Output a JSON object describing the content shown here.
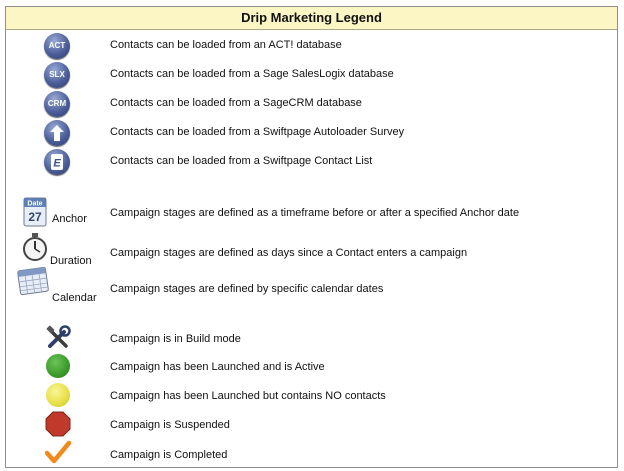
{
  "legend": {
    "title": "Drip Marketing Legend",
    "data_sources": [
      {
        "icon": "act-database-icon",
        "badge": "ACT",
        "text": "Contacts can be loaded from an ACT! database"
      },
      {
        "icon": "sage-saleslogix-icon",
        "badge": "SLX",
        "text": "Contacts can be loaded from a Sage SalesLogix database"
      },
      {
        "icon": "sagecrm-icon",
        "badge": "CRM",
        "text": "Contacts can be loaded from a SageCRM database"
      },
      {
        "icon": "autoloader-survey-icon",
        "badge": "",
        "text": "Contacts can be loaded from a Swiftpage Autoloader Survey"
      },
      {
        "icon": "contact-list-icon",
        "badge": "E",
        "text": "Contacts can be loaded from a Swiftpage Contact List"
      }
    ],
    "timeline_types": [
      {
        "icon": "anchor-date-icon",
        "label": "Anchor",
        "calendar_top": "Date",
        "calendar_day": "27",
        "text": "Campaign stages are defined as a timeframe before or after a specified Anchor date"
      },
      {
        "icon": "stopwatch-icon",
        "label": "Duration",
        "text": "Campaign stages are defined as days since a Contact enters a campaign"
      },
      {
        "icon": "calendar-icon",
        "label": "Calendar",
        "text": "Campaign stages are defined by specific calendar dates"
      }
    ],
    "statuses": [
      {
        "icon": "build-tools-icon",
        "text": "Campaign is in Build mode"
      },
      {
        "icon": "green-dot-icon",
        "color": "#3b9a2a",
        "text": "Campaign has been Launched and is Active"
      },
      {
        "icon": "yellow-dot-icon",
        "color": "#e6df45",
        "text": "Campaign has been Launched but contains NO contacts"
      },
      {
        "icon": "red-octagon-icon",
        "color": "#c0392b",
        "text": "Campaign is Suspended"
      },
      {
        "icon": "orange-checkmark-icon",
        "color": "#f2891b",
        "text": "Campaign is Completed"
      }
    ]
  }
}
